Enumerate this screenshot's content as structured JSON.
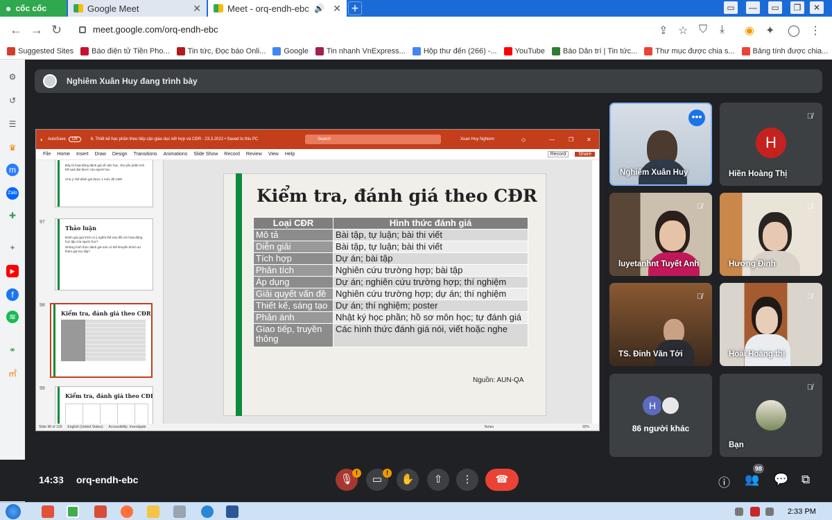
{
  "browser": {
    "brand": "cốc cốc",
    "tabs": [
      {
        "label": "Google Meet"
      },
      {
        "label": "Meet - orq-endh-ebc"
      }
    ],
    "url": "meet.google.com/orq-endh-ebc",
    "bookmarks": [
      {
        "label": "Suggested Sites",
        "color": "#d63b2f"
      },
      {
        "label": "Báo điện tử Tiền Pho...",
        "color": "#c8102e"
      },
      {
        "label": "Tin tức, Đọc báo Onli...",
        "color": "#b31b1b"
      },
      {
        "label": "Google",
        "color": "#4285f4"
      },
      {
        "label": "Tin nhanh VnExpress...",
        "color": "#9f224e"
      },
      {
        "label": "Hộp thư đến (266) -...",
        "color": "#4285f4"
      },
      {
        "label": "YouTube",
        "color": "#ff0000"
      },
      {
        "label": "Báo Dân trí | Tin tức...",
        "color": "#2e7d32"
      },
      {
        "label": "Thư mục được chia s...",
        "color": "#ea4335"
      },
      {
        "label": "Bảng tính được chia...",
        "color": "#ea4335"
      }
    ]
  },
  "presenter": {
    "text": "Nghiêm Xuân Huy đang trình bày"
  },
  "ppt": {
    "autosave": "AutoSave",
    "autosave_state": "Off",
    "file": "6. Thiết kế học phần theo tiếp cận giáo dục kết hợp và CĐR - 23.3.2022 • Saved to this PC",
    "search": "Search",
    "user": "Xuan Huy Nghiem",
    "menu": [
      "File",
      "Home",
      "Insert",
      "Draw",
      "Design",
      "Transitions",
      "Animations",
      "Slide Show",
      "Record",
      "Review",
      "View",
      "Help"
    ],
    "record_label": "Record",
    "share_label": "Share",
    "thumbs": [
      {
        "num": "",
        "title": "",
        "lines": [
          "Đây là hoạt động đánh giá về việc học, chủ yếu phần tích kết quả đạt được của người học",
          "Chú ý: thế đánh giá được 1 mức độ CĐR"
        ]
      },
      {
        "num": "97",
        "title": "Thảo luận",
        "lines": [
          "Đánh giá quá trình có ý nghĩa thế nào đối với hoạt động học tập của người học?",
          "Những hình thức đánh giá nào có thể khuyến khích sự tham gia học tập?"
        ]
      },
      {
        "num": "98",
        "title": "Kiểm tra, đánh giá theo CĐR",
        "lines": []
      },
      {
        "num": "99",
        "title": "Kiểm tra, đánh giá theo CĐR",
        "lines": []
      }
    ],
    "status": [
      "Slide 98 of 109",
      "English (United States)",
      "Accessibility: Investigate",
      "Notes",
      "92%"
    ]
  },
  "slide": {
    "title": "Kiểm tra, đánh giá theo CĐR",
    "headers": [
      "Loại CĐR",
      "Hình thức đánh giá"
    ],
    "rows": [
      [
        "Mô tả",
        "Bài tập, tự luận; bài thi viết"
      ],
      [
        "Diễn giải",
        "Bài tập, tự luận; bài thi viết"
      ],
      [
        "Tích hợp",
        "Dự án; bài tập"
      ],
      [
        "Phân tích",
        "Nghiên cứu trường hợp; bài tập"
      ],
      [
        "Áp dụng",
        "Dự án; nghiên cứu trường hợp; thí nghiệm"
      ],
      [
        "Giải quyết vấn đề",
        "Nghiên cứu trường hợp; dự án; thí nghiệm"
      ],
      [
        "Thiết kế, sáng tạo",
        "Dự án; thí nghiệm; poster"
      ],
      [
        "Phản ánh",
        "Nhật ký học phần; hồ sơ môn học; tự đánh giá"
      ],
      [
        "Giao tiếp, truyền thông",
        "Các hình thức đánh giá nói, viết hoặc nghe"
      ]
    ],
    "source": "Nguồn: AUN-QA"
  },
  "participants": [
    {
      "name": "Nghiêm Xuân Huy"
    },
    {
      "name": "Hiền Hoàng Thị",
      "initial": "H"
    },
    {
      "name": "luyetanhnt Tuyết Anh"
    },
    {
      "name": "Hương Đinh"
    },
    {
      "name": "TS. Đinh Văn Tới"
    },
    {
      "name": "Hoài Hoàng thị"
    },
    {
      "name": "86 người khác",
      "initial": "H"
    },
    {
      "name": "Bạn"
    }
  ],
  "meeting": {
    "time": "14:33",
    "code": "orq-endh-ebc",
    "participant_count": "98",
    "mic_alert": "!",
    "cam_alert": "!"
  },
  "taskbar": {
    "clock": "2:33 PM"
  },
  "colors": {
    "accent_blue": "#1a73e8",
    "hangup": "#ea4335",
    "ppt_red": "#c43e1c",
    "slide_green": "#0d8a3d"
  }
}
